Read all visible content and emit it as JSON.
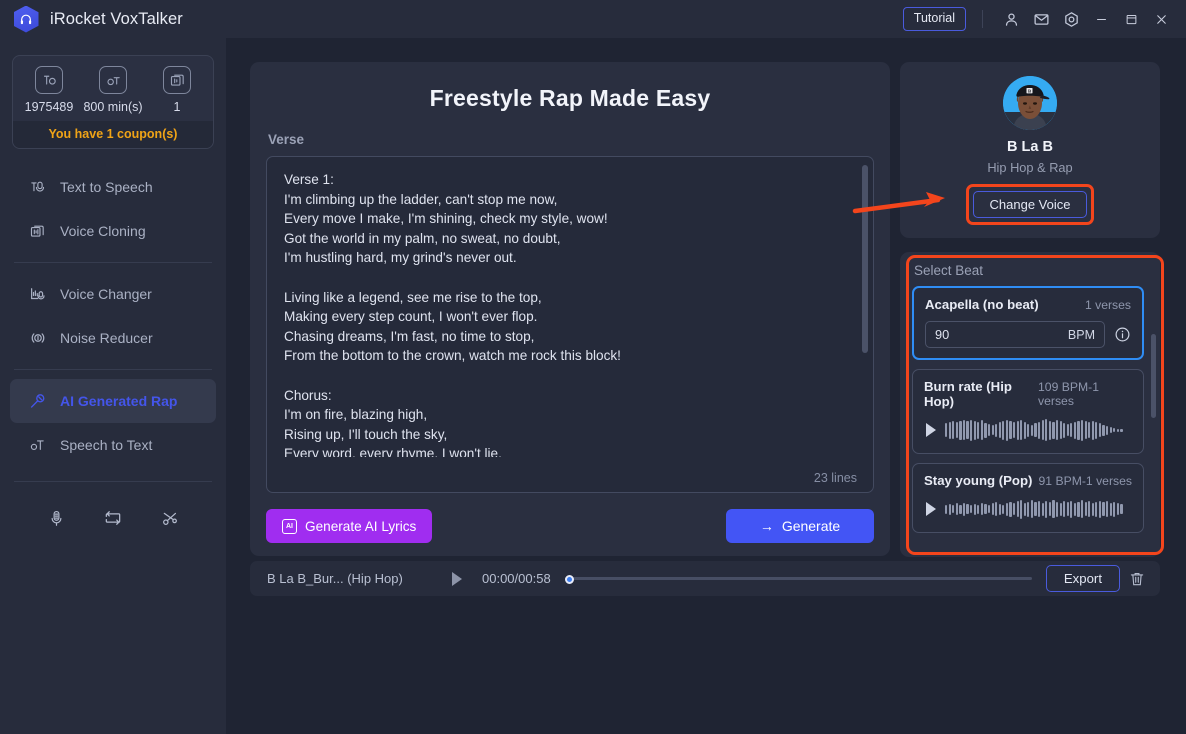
{
  "window": {
    "title": "iRocket VoxTalker",
    "tutorial_label": "Tutorial",
    "icons": [
      "account-icon",
      "mail-icon",
      "settings-icon",
      "minimize-icon",
      "maximize-icon",
      "close-icon"
    ]
  },
  "sidebar": {
    "credits": [
      {
        "icon": "characters-icon",
        "value": "1975489"
      },
      {
        "icon": "minutes-icon",
        "value": "800 min(s)"
      },
      {
        "icon": "clone-icon",
        "value": "1"
      }
    ],
    "coupon_text": "You have 1 coupon(s)",
    "items": [
      {
        "label": "Text to Speech",
        "icon": "text-to-speech-icon",
        "active": false
      },
      {
        "label": "Voice Cloning",
        "icon": "voice-cloning-icon",
        "active": false
      },
      {
        "label": "Voice Changer",
        "icon": "voice-changer-icon",
        "active": false
      },
      {
        "label": "Noise Reducer",
        "icon": "noise-reducer-icon",
        "active": false
      },
      {
        "label": "AI Generated Rap",
        "icon": "ai-rap-icon",
        "active": true
      },
      {
        "label": "Speech to Text",
        "icon": "speech-to-text-icon",
        "active": false
      }
    ],
    "tools": [
      "recorder-icon",
      "converter-icon",
      "cutter-icon"
    ]
  },
  "main": {
    "title": "Freestyle Rap Made Easy",
    "section_label": "Verse",
    "lyrics": "Verse 1:\nI'm climbing up the ladder, can't stop me now,\nEvery move I make, I'm shining, check my style, wow!\nGot the world in my palm, no sweat, no doubt,\nI'm hustling hard, my grind's never out.\n\nLiving like a legend, see me rise to the top,\nMaking every step count, I won't ever flop.\nChasing dreams, I'm fast, no time to stop,\nFrom the bottom to the crown, watch me rock this block!\n\nChorus:\nI'm on fire, blazing high,\nRising up, I'll touch the sky,\nEvery word, every rhyme, I won't lie,\nI'm a legend in the making, no goodbye.",
    "lines_count": "23 lines",
    "generate_ai_lyrics_label": "Generate AI Lyrics",
    "ai_badge_label": "AI",
    "generate_label": "Generate",
    "generate_arrow": "→"
  },
  "voice": {
    "name": "B La B",
    "genre": "Hip Hop & Rap",
    "change_voice_label": "Change Voice"
  },
  "beats": {
    "header": "Select Beat",
    "items": [
      {
        "name": "Acapella (no beat)",
        "meta": "1 verses",
        "selected": true,
        "bpm_value": "90",
        "bpm_unit": "BPM",
        "info_icon": "info-icon"
      },
      {
        "name": "Burn rate (Hip Hop)",
        "meta": "109 BPM-1 verses",
        "selected": false,
        "waveform": [
          14,
          17,
          18,
          16,
          19,
          20,
          18,
          21,
          19,
          17,
          20,
          15,
          12,
          10,
          13,
          16,
          19,
          21,
          18,
          16,
          19,
          20,
          17,
          13,
          11,
          14,
          17,
          20,
          22,
          19,
          17,
          20,
          18,
          15,
          12,
          14,
          17,
          19,
          21,
          18,
          16,
          19,
          17,
          14,
          11,
          9,
          6,
          4,
          3,
          3
        ]
      },
      {
        "name": "Stay young (Pop)",
        "meta": "91 BPM-1 verses",
        "selected": false,
        "waveform": [
          9,
          11,
          8,
          12,
          9,
          13,
          10,
          8,
          11,
          9,
          12,
          10,
          8,
          12,
          14,
          11,
          9,
          13,
          15,
          12,
          16,
          19,
          13,
          15,
          18,
          14,
          16,
          13,
          17,
          14,
          18,
          15,
          13,
          16,
          14,
          17,
          13,
          15,
          18,
          14,
          16,
          13,
          15,
          17,
          14,
          16,
          13,
          15,
          12,
          10
        ]
      }
    ]
  },
  "player": {
    "track_name": "B La B_Bur... (Hip Hop)",
    "time": "00:00/00:58",
    "progress_percent": 0,
    "export_label": "Export",
    "delete_icon": "trash-icon"
  },
  "annotations": {
    "arrow_color": "#f3451c",
    "highlight_color": "#f3451c"
  }
}
